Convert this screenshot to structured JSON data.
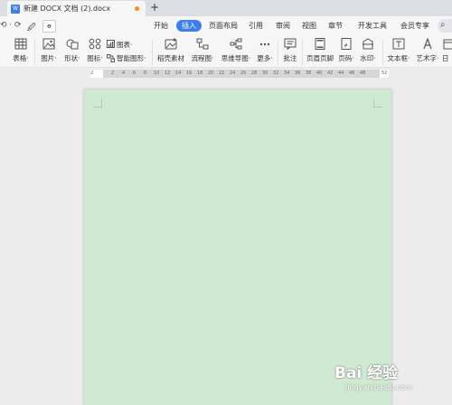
{
  "tab": {
    "title": "新建 DOCX 文档 (2).docx",
    "icon_text": "W",
    "new_tab": "+"
  },
  "quick_access": {
    "undo": "⟲",
    "undo_dd": "·",
    "redo": "⟳",
    "pen": "🖉",
    "box": "ꝋ"
  },
  "menu": [
    "开始",
    "插入",
    "页面布局",
    "引用",
    "审阅",
    "视图",
    "章节",
    "开发工具",
    "会员专享"
  ],
  "active_menu": "插入",
  "ribbon": {
    "table": "表格·",
    "picture": "图片·",
    "shape": "形状·",
    "icon": "图标·",
    "chart": "图表·",
    "smartart": "智能图形·",
    "material": "稻壳素材",
    "flowchart": "流程图·",
    "mindmap": "思维导图·",
    "more": "更多·",
    "comment": "批注",
    "header_footer": "页眉页脚",
    "page_number": "页码·",
    "watermark": "水印·",
    "textbox": "文本框·",
    "art_text": "艺术字·",
    "date": "日"
  },
  "ruler": [
    "2",
    "2",
    "4",
    "6",
    "8",
    "10",
    "12",
    "14",
    "16",
    "18",
    "20",
    "22",
    "24",
    "26",
    "28",
    "30",
    "32",
    "34",
    "36",
    "38",
    "40",
    "42",
    "44",
    "46",
    "48",
    "52"
  ],
  "watermark": {
    "brand": "Bai 经验",
    "url": "jingyan.baidu.com"
  },
  "colors": {
    "accent": "#3b7ef0",
    "page": "#ceead0",
    "tab_dot": "#ff8c1a"
  }
}
